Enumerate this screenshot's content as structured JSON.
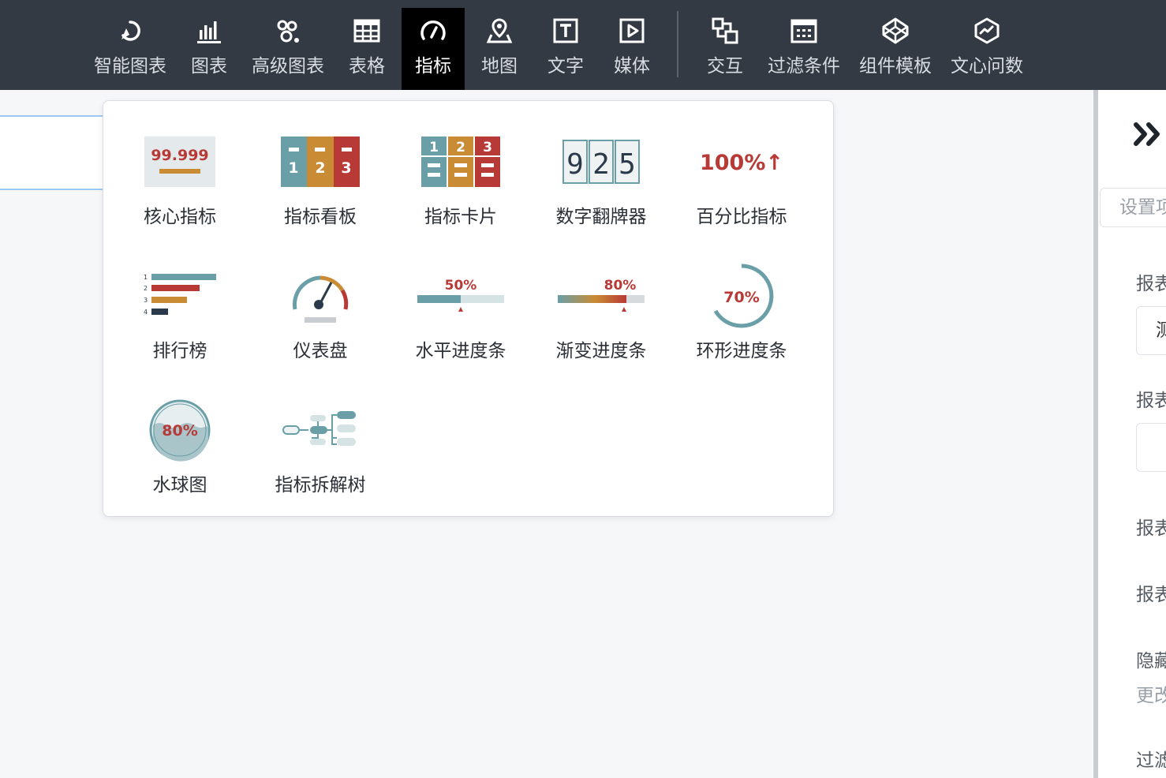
{
  "toolbar": {
    "items": [
      {
        "label": "智能图表",
        "icon": "smart-chart-icon"
      },
      {
        "label": "图表",
        "icon": "bar-chart-icon"
      },
      {
        "label": "高级图表",
        "icon": "advanced-chart-icon"
      },
      {
        "label": "表格",
        "icon": "table-icon"
      },
      {
        "label": "指标",
        "icon": "gauge-icon",
        "active": true
      },
      {
        "label": "地图",
        "icon": "map-pin-icon"
      },
      {
        "label": "文字",
        "icon": "text-icon"
      },
      {
        "label": "媒体",
        "icon": "media-play-icon"
      },
      {
        "label": "交互",
        "icon": "interaction-icon"
      },
      {
        "label": "过滤条件",
        "icon": "filter-calendar-icon"
      },
      {
        "label": "组件模板",
        "icon": "component-template-icon"
      },
      {
        "label": "文心问数",
        "icon": "wenxin-icon"
      }
    ]
  },
  "dropdown": {
    "items": [
      {
        "label": "核心指标",
        "icon": "core-metric-icon",
        "thumb_text": "99.999"
      },
      {
        "label": "指标看板",
        "icon": "metric-board-icon",
        "thumb_text": [
          "1",
          "2",
          "3"
        ]
      },
      {
        "label": "指标卡片",
        "icon": "metric-card-icon",
        "thumb_text": [
          "1",
          "2",
          "3"
        ]
      },
      {
        "label": "数字翻牌器",
        "icon": "digit-flipper-icon",
        "thumb_text": [
          "9",
          "2",
          "5"
        ]
      },
      {
        "label": "百分比指标",
        "icon": "percent-metric-icon",
        "thumb_text": "100%↑"
      },
      {
        "label": "排行榜",
        "icon": "ranking-icon",
        "thumb_text": [
          "1",
          "2",
          "3",
          "4"
        ]
      },
      {
        "label": "仪表盘",
        "icon": "dashboard-gauge-icon"
      },
      {
        "label": "水平进度条",
        "icon": "horizontal-progress-icon",
        "thumb_text": "50%"
      },
      {
        "label": "渐变进度条",
        "icon": "gradient-progress-icon",
        "thumb_text": "80%"
      },
      {
        "label": "环形进度条",
        "icon": "ring-progress-icon",
        "thumb_text": "70%"
      },
      {
        "label": "水球图",
        "icon": "liquid-ball-icon",
        "thumb_text": "80%"
      },
      {
        "label": "指标拆解树",
        "icon": "metric-tree-icon"
      }
    ]
  },
  "right_panel": {
    "settings_tab": "设置项",
    "labels": [
      "报表",
      "报表",
      "报表",
      "报表",
      "隐藏"
    ],
    "field_1": "测",
    "sub_text": "更改",
    "bottom_label": "过滤"
  },
  "colors": {
    "toolbar_bg": "#343a43",
    "active_bg": "#000000",
    "teal": "#6a9fa8",
    "red": "#b83a37",
    "orange": "#c98b33",
    "navy": "#2b3a4a"
  }
}
